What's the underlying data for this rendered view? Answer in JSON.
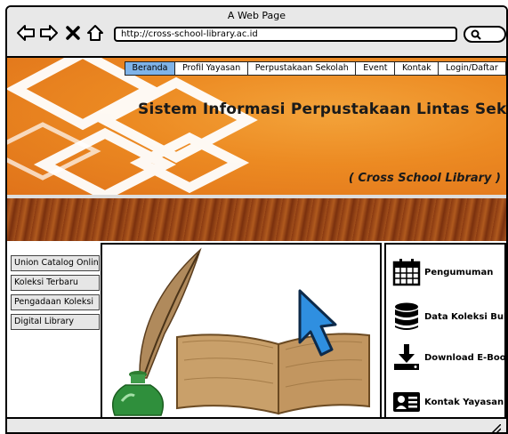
{
  "window": {
    "title": "A Web Page",
    "url": "http://cross-school-library.ac.id"
  },
  "menu": {
    "items": [
      "Beranda",
      "Profil Yayasan",
      "Perpustakaan Sekolah",
      "Event",
      "Kontak",
      "Login/Daftar"
    ],
    "active_index": 0
  },
  "banner": {
    "title": "Sistem Informasi Perpustakaan Lintas Sekolah",
    "subtitle": "( Cross School Library )"
  },
  "sidebar": {
    "items": [
      "Union Catalog Online",
      "Koleksi Terbaru",
      "Pengadaan Koleksi",
      "Digital Library"
    ]
  },
  "panel": {
    "items": [
      {
        "label": "Pengumuman",
        "icon": "calendar-icon"
      },
      {
        "label": "Data Koleksi Buku",
        "icon": "database-icon"
      },
      {
        "label": "Download E-Book",
        "icon": "download-icon"
      },
      {
        "label": "Kontak Yayasan",
        "icon": "contact-card-icon"
      }
    ]
  },
  "colors": {
    "banner": "#ec8a22",
    "active_menu": "#7fb3e8",
    "cursor": "#2f8fe0"
  }
}
